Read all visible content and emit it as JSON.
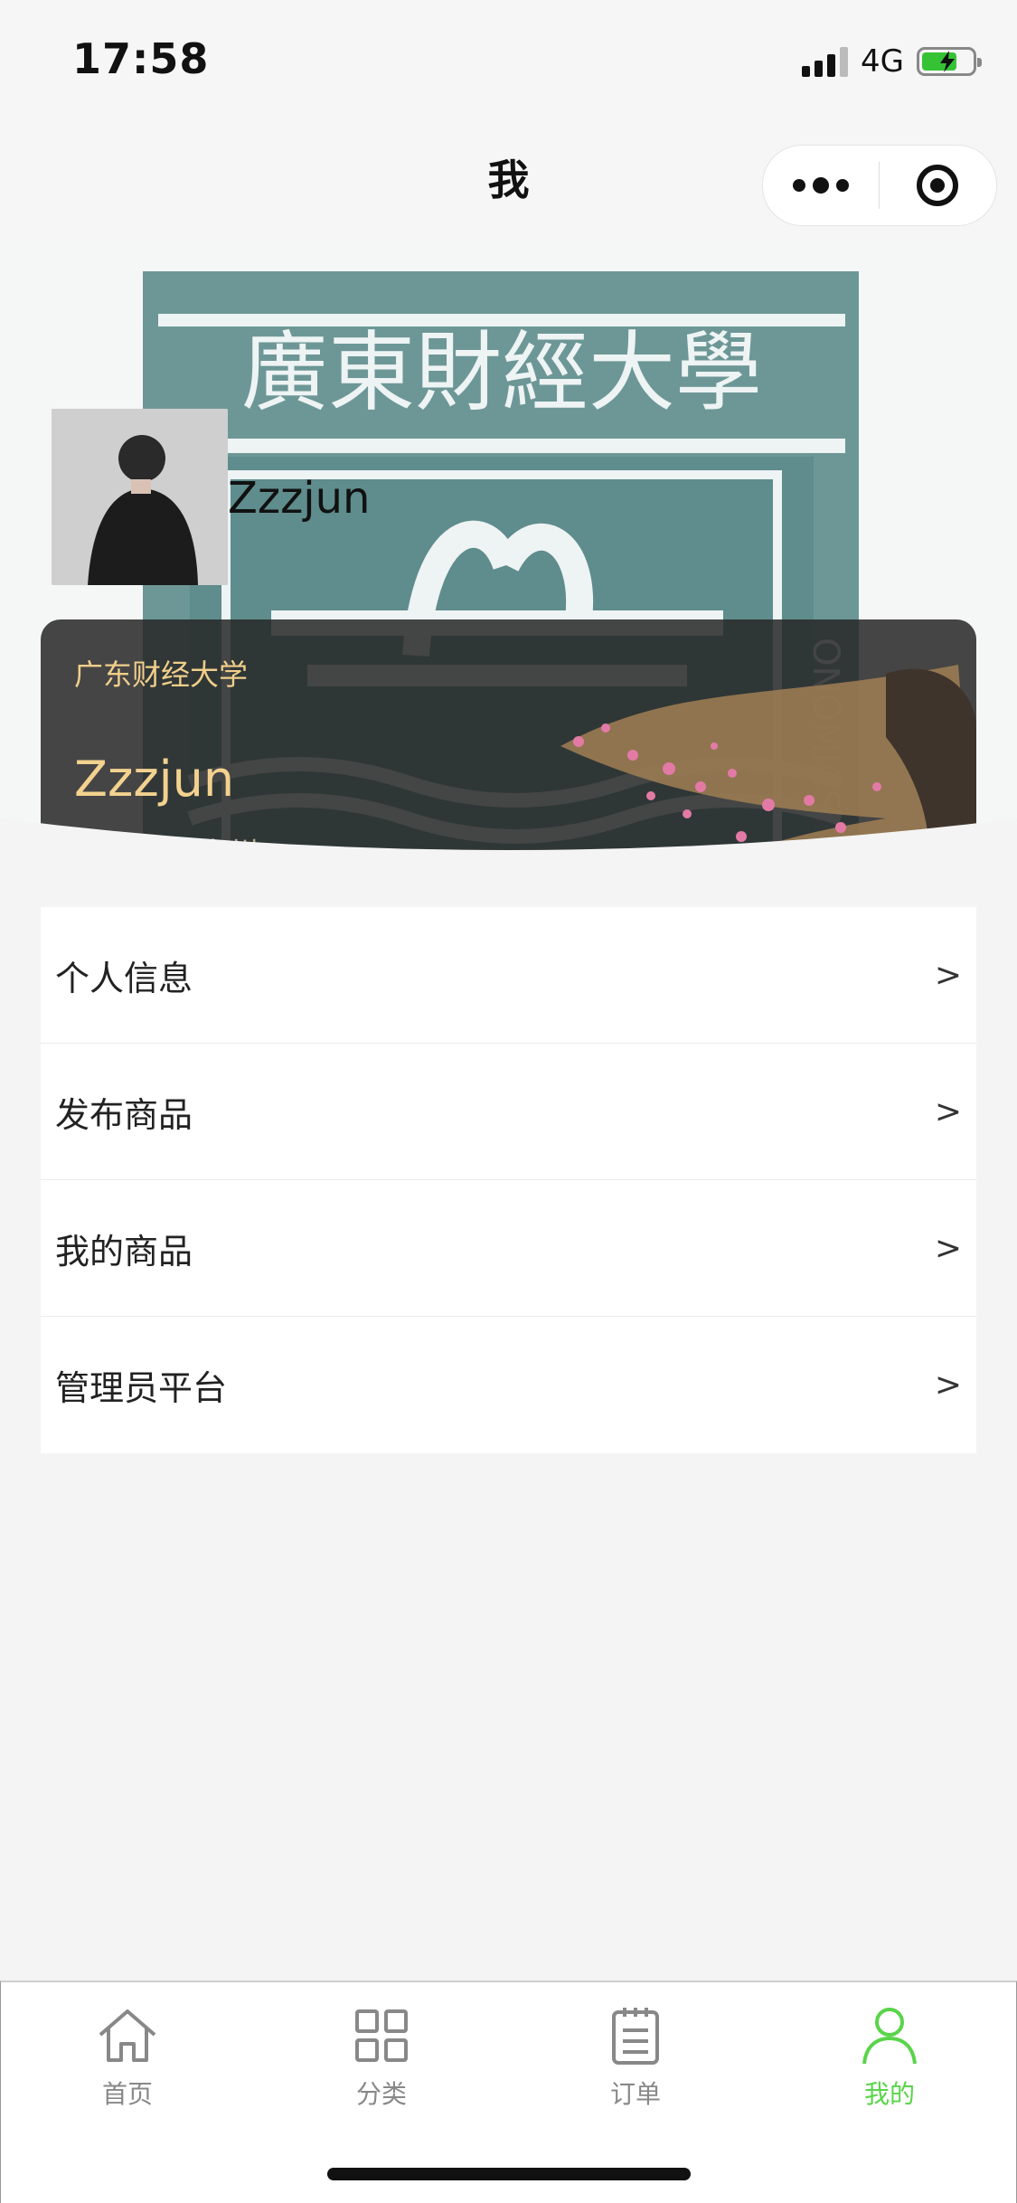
{
  "status_bar": {
    "time": "17:58",
    "network": "4G",
    "battery_color": "#35c335"
  },
  "nav": {
    "title": "我",
    "more_icon": "more-dots-icon",
    "close_icon": "target-icon"
  },
  "profile": {
    "banner_text": "廣東財經大學",
    "username": "Zzzjun",
    "card": {
      "school": "广东财经大学",
      "name": "Zzzjun",
      "location": "中国广东广州"
    }
  },
  "menu": [
    {
      "label": "个人信息",
      "arrow": ">"
    },
    {
      "label": "发布商品",
      "arrow": ">"
    },
    {
      "label": "我的商品",
      "arrow": ">"
    },
    {
      "label": "管理员平台",
      "arrow": ">"
    }
  ],
  "tabbar": {
    "active_color": "#5ad44a",
    "items": [
      {
        "label": "首页",
        "icon": "home-icon"
      },
      {
        "label": "分类",
        "icon": "grid-icon"
      },
      {
        "label": "订单",
        "icon": "order-list-icon"
      },
      {
        "label": "我的",
        "icon": "user-icon",
        "active": true
      }
    ]
  }
}
